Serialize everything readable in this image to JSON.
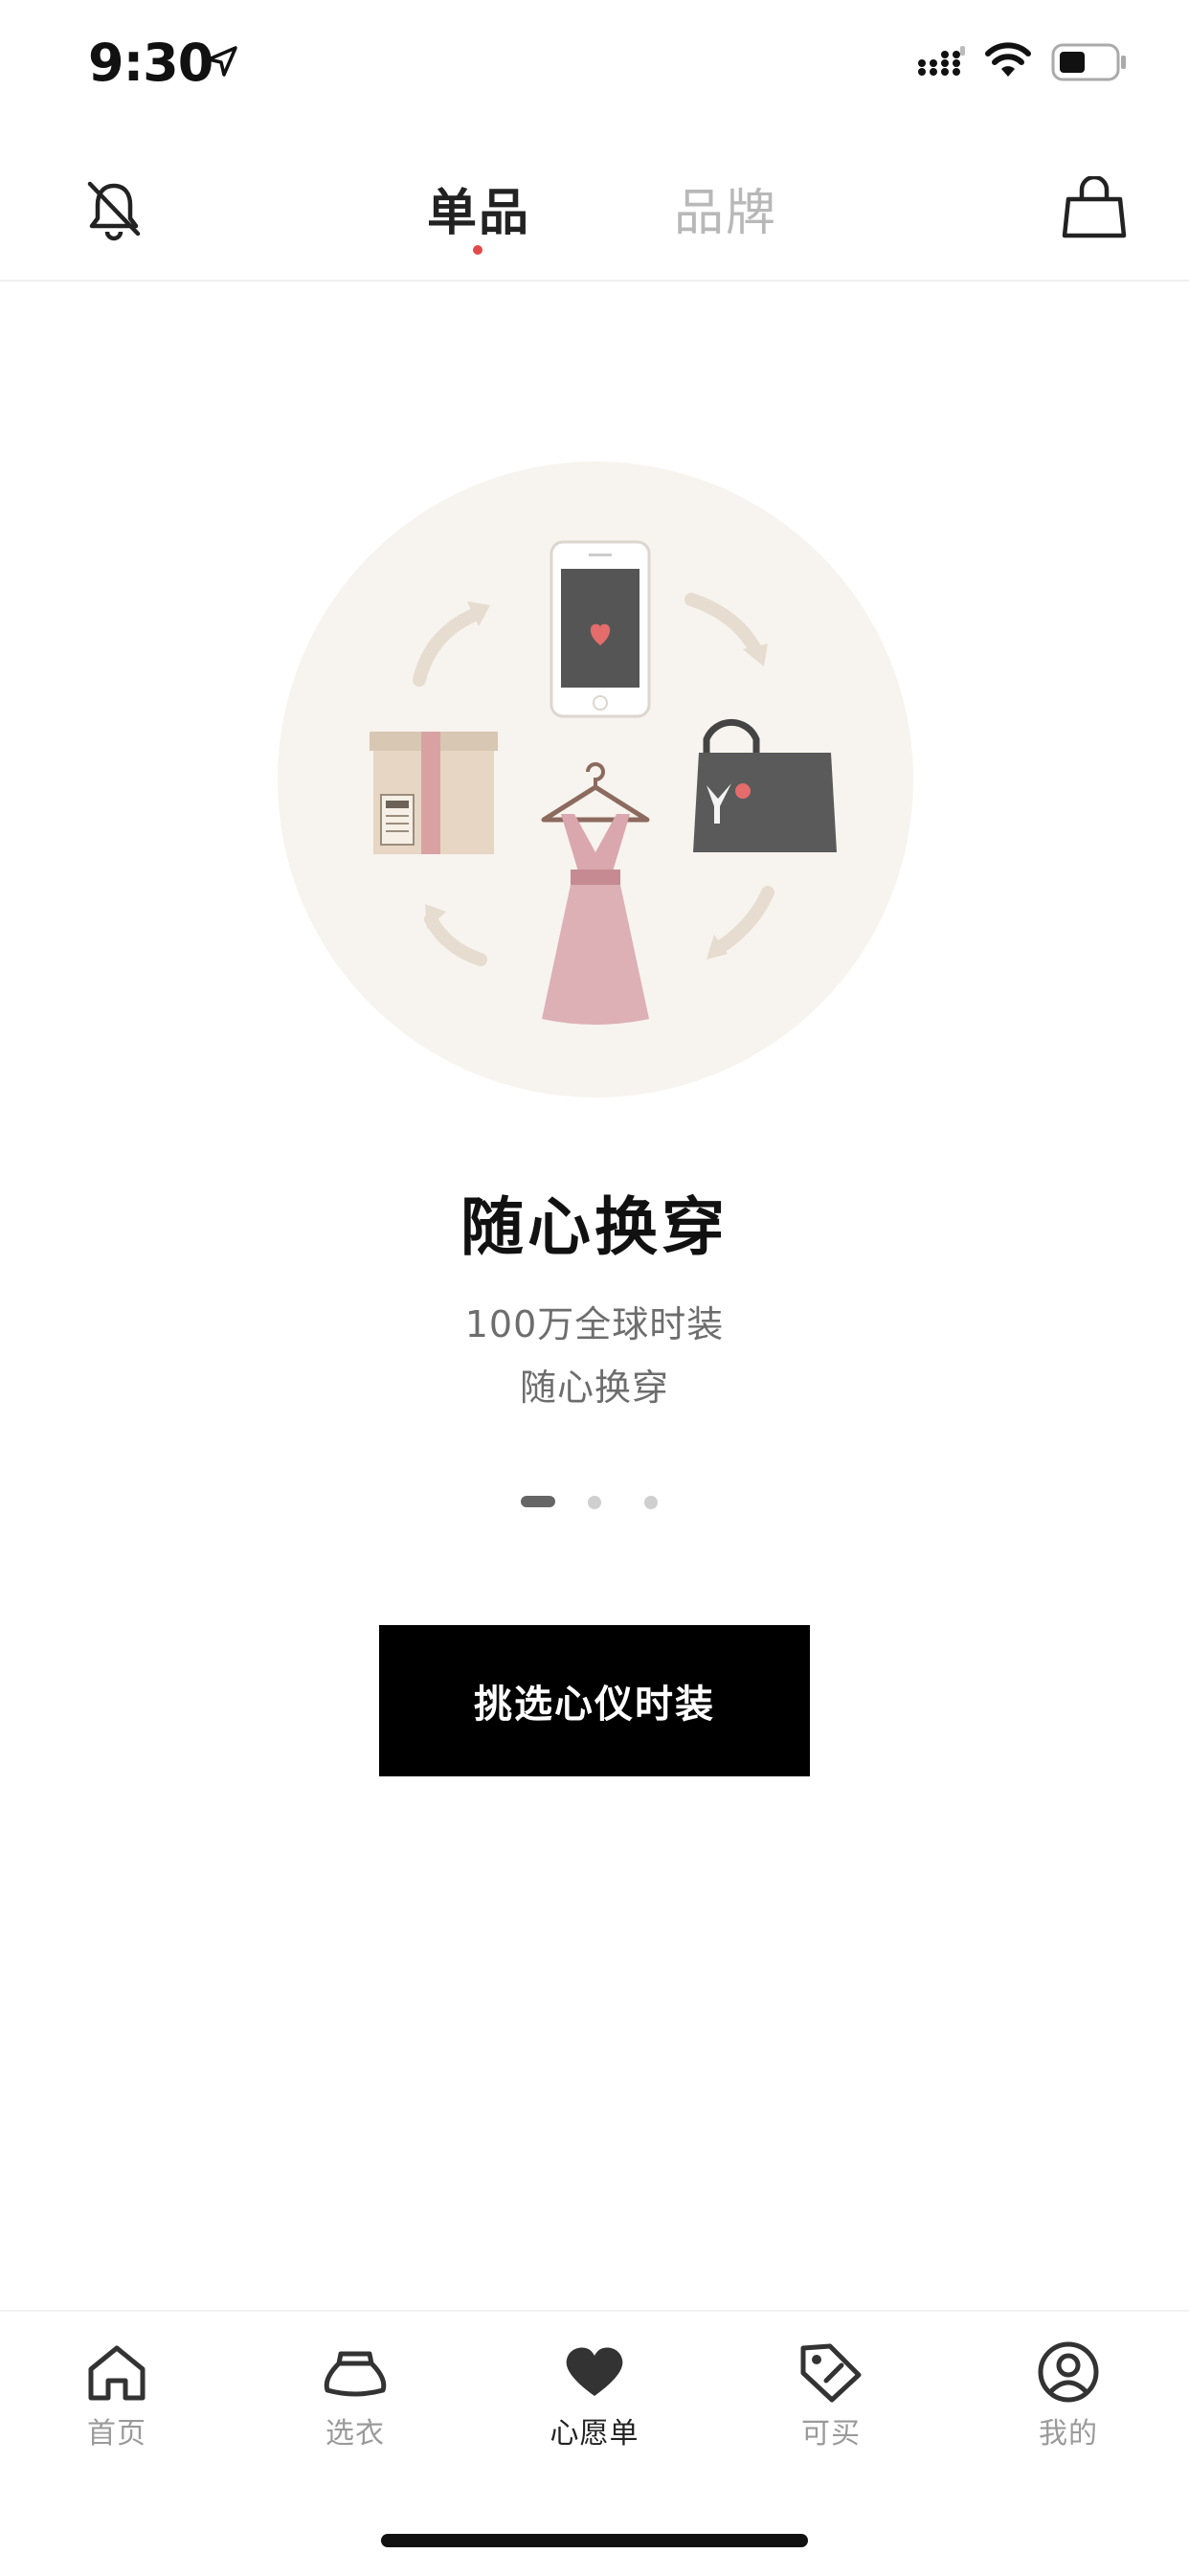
{
  "status_bar": {
    "time": "9:30"
  },
  "top_nav": {
    "tabs": [
      {
        "label": "单品",
        "active": true
      },
      {
        "label": "品牌",
        "active": false
      }
    ],
    "accent": "#e24a4a"
  },
  "hero": {
    "title": "随心换穿",
    "subtitle_line1": "100万全球时装",
    "subtitle_line2": "随心换穿",
    "pager": {
      "current": 1,
      "total": 3
    }
  },
  "cta": {
    "label": "挑选心仪时装"
  },
  "tab_bar": {
    "items": [
      {
        "label": "首页",
        "icon": "home-icon",
        "active": false
      },
      {
        "label": "选衣",
        "icon": "skirt-icon",
        "active": false
      },
      {
        "label": "心愿单",
        "icon": "heart-icon",
        "active": true
      },
      {
        "label": "可买",
        "icon": "tag-icon",
        "active": false
      },
      {
        "label": "我的",
        "icon": "profile-icon",
        "active": false
      }
    ]
  }
}
